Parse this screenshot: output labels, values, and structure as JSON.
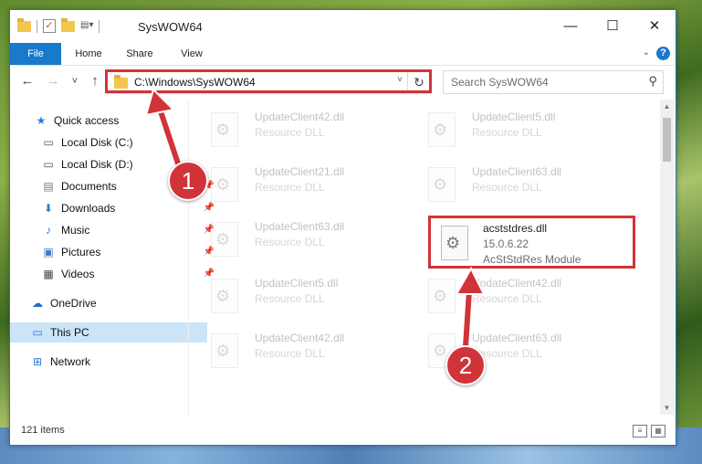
{
  "window": {
    "title": "SysWOW64",
    "minimize": "—",
    "maximize": "☐",
    "close": "✕"
  },
  "ribbon": {
    "tabs": [
      "File",
      "Home",
      "Share",
      "View"
    ],
    "help": "?"
  },
  "navigation": {
    "back": "←",
    "forward": "→",
    "recent": "˅",
    "up": "↑",
    "address": "C:\\Windows\\SysWOW64",
    "address_dropdown": "˅",
    "refresh": "↻",
    "search_placeholder": "Search SysWOW64",
    "search_icon": "⚲"
  },
  "sidebar": {
    "items": [
      {
        "label": "Quick access",
        "icon": "star-icon"
      },
      {
        "label": "Local Disk (C:)",
        "icon": "drive-icon"
      },
      {
        "label": "Local Disk (D:)",
        "icon": "drive-icon"
      },
      {
        "label": "Documents",
        "icon": "documents-icon"
      },
      {
        "label": "Downloads",
        "icon": "downloads-icon"
      },
      {
        "label": "Music",
        "icon": "music-icon"
      },
      {
        "label": "Pictures",
        "icon": "pictures-icon"
      },
      {
        "label": "Videos",
        "icon": "videos-icon"
      },
      {
        "label": "OneDrive",
        "icon": "cloud-icon"
      },
      {
        "label": "This PC",
        "icon": "computer-icon"
      },
      {
        "label": "Network",
        "icon": "network-icon"
      }
    ]
  },
  "files": [
    {
      "name": "UpdateClient42.dll",
      "type": "Resource DLL"
    },
    {
      "name": "UpdateClient5.dll",
      "type": "Resource DLL"
    },
    {
      "name": "UpdateClient21.dll",
      "type": "Resource DLL"
    },
    {
      "name": "UpdateClient63.dll",
      "type": "Resource DLL"
    },
    {
      "name": "UpdateClient63.dll",
      "type": "Resource DLL"
    },
    {
      "name": "acststdres.dll",
      "version": "15.0.6.22",
      "type": "AcStStdRes Module"
    },
    {
      "name": "UpdateClient5.dll",
      "type": "Resource DLL"
    },
    {
      "name": "UpdateClient42.dll",
      "type": "Resource DLL"
    },
    {
      "name": "UpdateClient42.dll",
      "type": "Resource DLL"
    },
    {
      "name": "UpdateClient63.dll",
      "type": "Resource DLL"
    }
  ],
  "status": {
    "item_count": "121 items"
  },
  "annotations": {
    "step1": "1",
    "step2": "2",
    "highlight_color": "#d13438"
  }
}
